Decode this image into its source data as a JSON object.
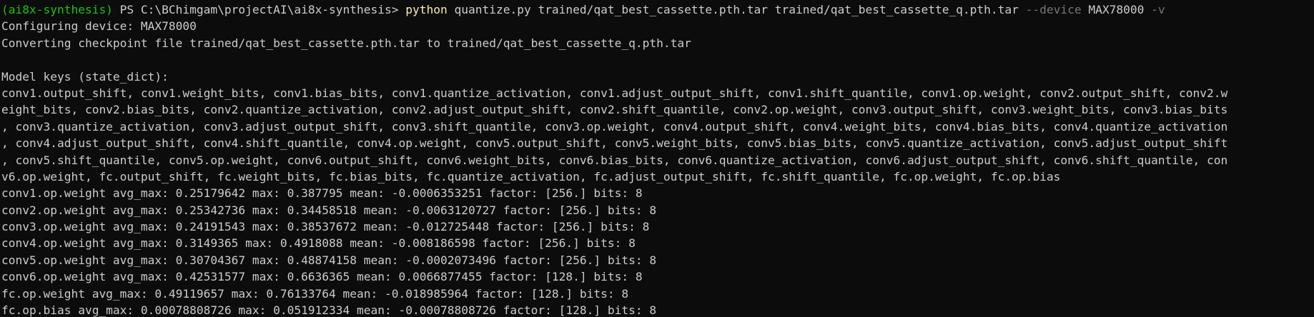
{
  "prompt": {
    "env": "(ai8x-synthesis)",
    "path": " PS C:\\BChimgam\\projectAI\\ai8x-synthesis> "
  },
  "command": {
    "exe": "python",
    "args1": " quantize.py trained/qat_best_cassette.pth.tar trained/qat_best_cassette_q.pth.tar ",
    "flag_device": "--device",
    "device_value": " MAX78000 ",
    "flag_v": "-v"
  },
  "output_lines": [
    "Configuring device: MAX78000",
    "Converting checkpoint file trained/qat_best_cassette.pth.tar to trained/qat_best_cassette_q.pth.tar",
    "",
    "Model keys (state_dict):",
    "conv1.output_shift, conv1.weight_bits, conv1.bias_bits, conv1.quantize_activation, conv1.adjust_output_shift, conv1.shift_quantile, conv1.op.weight, conv2.output_shift, conv2.w",
    "eight_bits, conv2.bias_bits, conv2.quantize_activation, conv2.adjust_output_shift, conv2.shift_quantile, conv2.op.weight, conv3.output_shift, conv3.weight_bits, conv3.bias_bits",
    ", conv3.quantize_activation, conv3.adjust_output_shift, conv3.shift_quantile, conv3.op.weight, conv4.output_shift, conv4.weight_bits, conv4.bias_bits, conv4.quantize_activation",
    ", conv4.adjust_output_shift, conv4.shift_quantile, conv4.op.weight, conv5.output_shift, conv5.weight_bits, conv5.bias_bits, conv5.quantize_activation, conv5.adjust_output_shift",
    ", conv5.shift_quantile, conv5.op.weight, conv6.output_shift, conv6.weight_bits, conv6.bias_bits, conv6.quantize_activation, conv6.adjust_output_shift, conv6.shift_quantile, con",
    "v6.op.weight, fc.output_shift, fc.weight_bits, fc.bias_bits, fc.quantize_activation, fc.adjust_output_shift, fc.shift_quantile, fc.op.weight, fc.op.bias",
    "conv1.op.weight avg_max: 0.25179642 max: 0.387795 mean: -0.0006353251 factor: [256.] bits: 8",
    "conv2.op.weight avg_max: 0.25342736 max: 0.34458518 mean: -0.0063120727 factor: [256.] bits: 8",
    "conv3.op.weight avg_max: 0.24191543 max: 0.38537672 mean: -0.012725448 factor: [256.] bits: 8",
    "conv4.op.weight avg_max: 0.3149365 max: 0.4918088 mean: -0.008186598 factor: [256.] bits: 8",
    "conv5.op.weight avg_max: 0.30704367 max: 0.48874158 mean: -0.0002073496 factor: [256.] bits: 8",
    "conv6.op.weight avg_max: 0.42531577 max: 0.6636365 mean: 0.0066877455 factor: [128.] bits: 8",
    "fc.op.weight avg_max: 0.49119657 max: 0.76133764 mean: -0.018985964 factor: [128.] bits: 8",
    "fc.op.bias avg_max: 0.00078808726 max: 0.051912334 mean: -0.00078808726 factor: [128.] bits: 8"
  ],
  "colors": {
    "background": "#0c0c0c",
    "text": "#cccccc",
    "prompt_env": "#16c60c",
    "command_exe": "#f9f1a5",
    "command_flag": "#767676"
  }
}
